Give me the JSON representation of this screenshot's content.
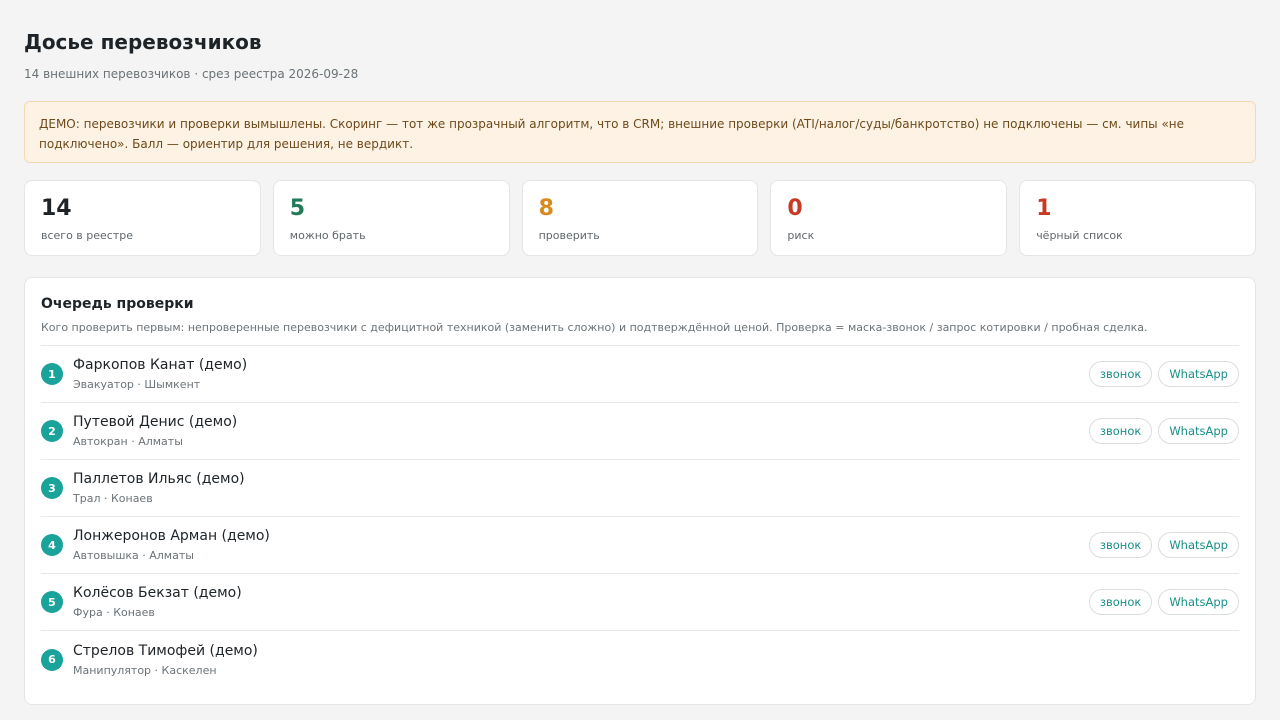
{
  "header": {
    "title": "Досье перевозчиков",
    "subtitle": "14 внешних перевозчиков · срез реестра 2026-09-28"
  },
  "notice": {
    "text": "ДЕМО: перевозчики и проверки вымышлены. Скоринг — тот же прозрачный алгоритм, что в CRM; внешние проверки (ATI/налог/суды/банкротство) не подключены — см. чипы «не подключено». Балл — ориентир для решения, не вердикт."
  },
  "stats": [
    {
      "value": "14",
      "label": "всего в реестре",
      "color": "#1d2327"
    },
    {
      "value": "5",
      "label": "можно брать",
      "color": "#1e7a57"
    },
    {
      "value": "8",
      "label": "проверить",
      "color": "#d98a1e"
    },
    {
      "value": "0",
      "label": "риск",
      "color": "#c83a25"
    },
    {
      "value": "1",
      "label": "чёрный список",
      "color": "#c83a25"
    }
  ],
  "queue": {
    "title": "Очередь проверки",
    "description": "Кого проверить первым: непроверенные перевозчики с дефицитной техникой (заменить сложно) и подтверждённой ценой. Проверка = маска-звонок / запрос котировки / пробная сделка.",
    "call_label": "звонок",
    "whatsapp_label": "WhatsApp",
    "items": [
      {
        "rank": "1",
        "name": "Фаркопов Канат (демо)",
        "meta": "Эвакуатор · Шымкент",
        "has_contacts": true
      },
      {
        "rank": "2",
        "name": "Путевой Денис (демо)",
        "meta": "Автокран · Алматы",
        "has_contacts": true
      },
      {
        "rank": "3",
        "name": "Паллетов Ильяс (демо)",
        "meta": "Трал · Конаев",
        "has_contacts": false
      },
      {
        "rank": "4",
        "name": "Лонжеронов Арман (демо)",
        "meta": "Автовышка · Алматы",
        "has_contacts": true
      },
      {
        "rank": "5",
        "name": "Колёсов Бекзат (демо)",
        "meta": "Фура · Конаев",
        "has_contacts": true
      },
      {
        "rank": "6",
        "name": "Стрелов Тимофей (демо)",
        "meta": "Манипулятор · Каскелен",
        "has_contacts": false
      }
    ]
  }
}
